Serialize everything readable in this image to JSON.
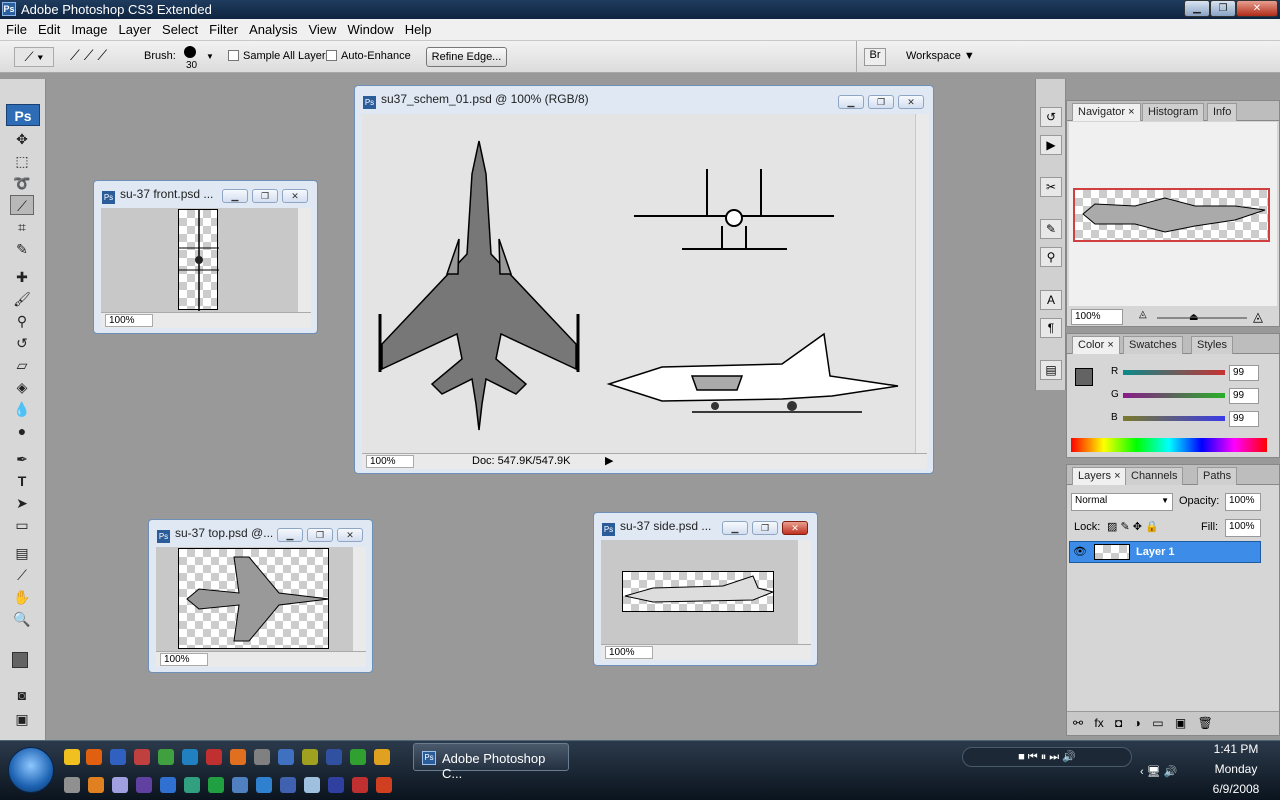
{
  "app": {
    "title": "Adobe Photoshop CS3 Extended",
    "logo": "Ps"
  },
  "menu": [
    "File",
    "Edit",
    "Image",
    "Layer",
    "Select",
    "Filter",
    "Analysis",
    "View",
    "Window",
    "Help"
  ],
  "options_bar": {
    "brush_label": "Brush:",
    "brush_size": "30",
    "sample_all_layers": "Sample All Layers",
    "auto_enhance": "Auto-Enhance",
    "refine_edge": "Refine Edge...",
    "workspace": "Workspace"
  },
  "documents": {
    "main": {
      "title": "su37_schem_01.psd @ 100% (RGB/8)",
      "zoom": "100%",
      "doc_info": "Doc: 547.9K/547.9K"
    },
    "front": {
      "title": "su-37 front.psd ...",
      "zoom": "100%"
    },
    "top": {
      "title": "su-37 top.psd @...",
      "zoom": "100%"
    },
    "side": {
      "title": "su-37 side.psd ...",
      "zoom": "100%"
    }
  },
  "navigator": {
    "tabs": [
      "Navigator",
      "Histogram",
      "Info"
    ],
    "zoom": "100%"
  },
  "color": {
    "tabs": [
      "Color",
      "Swatches",
      "Styles"
    ],
    "channels": [
      {
        "label": "R",
        "value": "99"
      },
      {
        "label": "G",
        "value": "99"
      },
      {
        "label": "B",
        "value": "99"
      }
    ],
    "foreground": "#636363"
  },
  "layers": {
    "tabs": [
      "Layers",
      "Channels",
      "Paths"
    ],
    "blend_mode": "Normal",
    "opacity_label": "Opacity:",
    "opacity": "100%",
    "lock_label": "Lock:",
    "fill_label": "Fill:",
    "fill": "100%",
    "items": [
      {
        "name": "Layer 1"
      }
    ]
  },
  "taskbar": {
    "task_label": "Adobe Photoshop C...",
    "time": "1:41 PM",
    "day": "Monday",
    "date": "6/9/2008"
  }
}
